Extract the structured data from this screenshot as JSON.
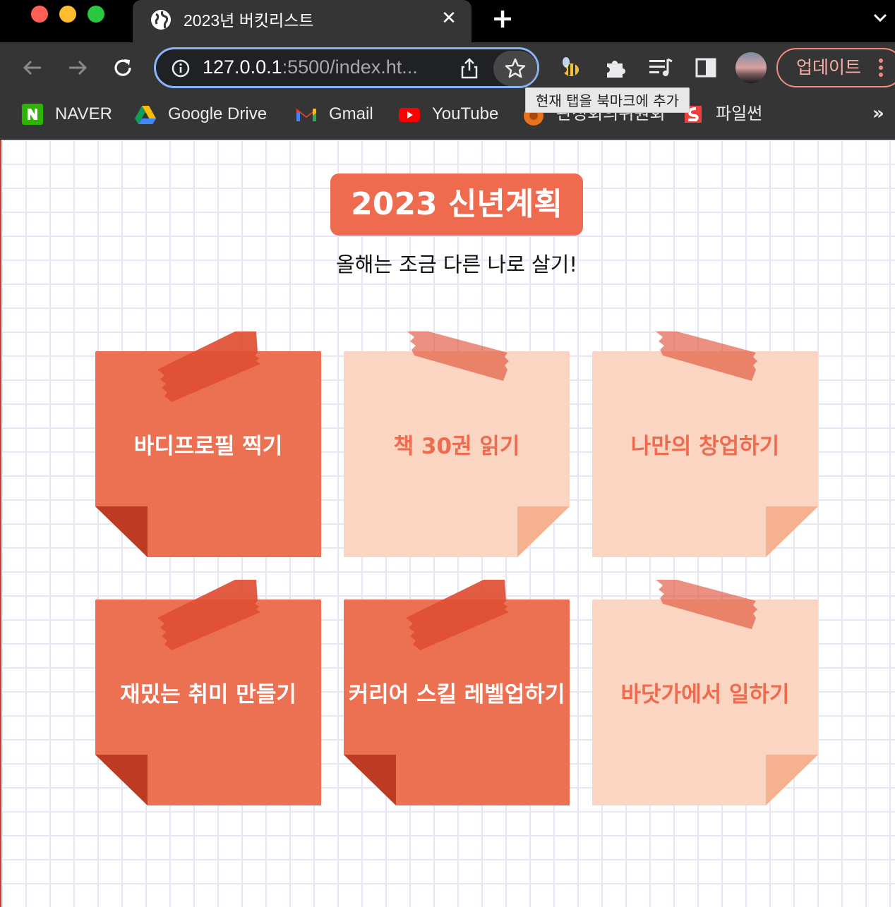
{
  "browser": {
    "tab": {
      "title": "2023년 버킷리스트"
    },
    "url": {
      "host": "127.0.0.1",
      "rest": ":5500/index.ht..."
    },
    "update_label": "업데이트",
    "tooltip": "현재 탭을 북마크에 추가",
    "bookmarks": [
      {
        "label": "NAVER",
        "icon": "naver-icon"
      },
      {
        "label": "Google Drive",
        "icon": "google-drive-icon"
      },
      {
        "label": "Gmail",
        "icon": "gmail-icon"
      },
      {
        "label": "YouTube",
        "icon": "youtube-icon"
      },
      {
        "label": "관정회의위원회",
        "icon": "orange-circle-icon"
      },
      {
        "label": "파일썬",
        "icon": "filesun-icon"
      }
    ]
  },
  "page": {
    "title": "2023 신년계획",
    "subtitle": "올해는 조금 다른 나로 살기!",
    "notes": [
      {
        "text": "바디프로필 찍기",
        "style": "dark"
      },
      {
        "text": "책 30권 읽기",
        "style": "light"
      },
      {
        "text": "나만의 창업하기",
        "style": "light"
      },
      {
        "text": "재밌는 취미 만들기",
        "style": "dark"
      },
      {
        "text": "커리어 스킬 레벨업하기",
        "style": "dark"
      },
      {
        "text": "바닷가에서 일하기",
        "style": "light"
      }
    ]
  },
  "colors": {
    "accent": "#ee6b50",
    "note_dark": "#ec7052",
    "note_dark_fold": "#bd3b22",
    "note_light": "#fad5c1",
    "note_light_fold": "#f6b28f",
    "tape": "#e04e33"
  }
}
